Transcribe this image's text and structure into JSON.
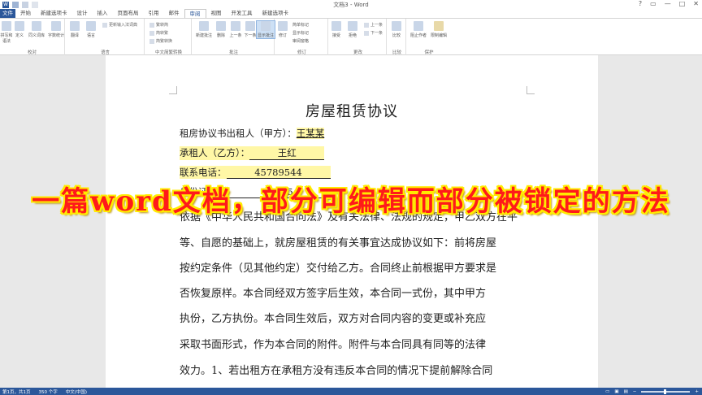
{
  "window": {
    "title": "文档3 - Word",
    "controls": [
      "?",
      "▭",
      "—",
      "□",
      "✕"
    ]
  },
  "ribbon_tabs": [
    "文件",
    "开始",
    "新建选项卡",
    "设计",
    "插入",
    "页面布局",
    "引用",
    "邮件",
    "审阅",
    "视图",
    "开发工具",
    "新建选项卡"
  ],
  "ribbon": {
    "proofing": {
      "label": "校对",
      "buttons": [
        "拼写和语法",
        "定义",
        "同义词库",
        "字数统计"
      ]
    },
    "language": {
      "label": "语言",
      "buttons": [
        "翻译",
        "语言"
      ],
      "small": "更新输入法词典"
    },
    "chinese": {
      "label": "中文简繁转换",
      "items": [
        "繁转简",
        "简转繁",
        "简繁转换"
      ]
    },
    "comments": {
      "label": "批注",
      "buttons": [
        "新建批注",
        "删除",
        "上一条",
        "下一条",
        "显示批注"
      ]
    },
    "tracking": {
      "label": "修订",
      "buttons": [
        "修订"
      ],
      "dropdowns": [
        "简单标记",
        "显示标记",
        "审阅窗格"
      ]
    },
    "changes": {
      "label": "更改",
      "buttons": [
        "接受",
        "拒绝"
      ],
      "small": [
        "上一条",
        "下一条"
      ]
    },
    "compare": {
      "label": "比较",
      "buttons": [
        "比较"
      ]
    },
    "protect": {
      "label": "保护",
      "buttons": [
        "阻止作者",
        "限制编辑"
      ]
    }
  },
  "document": {
    "title": "房屋租赁协议",
    "lessor_line": "租房协议书出租人（甲方）：",
    "lessor_name": "王某某",
    "lessee_label": "承租人（乙方）：",
    "lessee_name": "王红",
    "phone_label": "联系电话：",
    "phone_value": "45789544",
    "id_label": "身份证号：",
    "id_value": "9  3  25",
    "paragraphs": [
      "依据《中华人民共和国合同法》及有关法律、法规的规定，甲乙双方在平",
      "等、自愿的基础上，就房屋租赁的有关事宜达成协议如下：前将房屋",
      "按约定条件（见其他约定）交付给乙方。合同终止前根据甲方要求是",
      "否恢复原样。本合同经双方签字后生效，本合同一式份，其中甲方",
      "执份，乙方执份。本合同生效后，双方对合同内容的变更或补充应",
      "采取书面形式，作为本合同的附件。附件与本合同具有同等的法律",
      "效力。1、若出租方在承租方没有违反本合同的情况下提前解除合同"
    ]
  },
  "banner": "一篇word文档，部分可编辑而部分被锁定的方法",
  "status": {
    "page": "第1页，共1页",
    "words": "350 个字",
    "lang": "中文(中国)"
  },
  "colors": {
    "accent": "#2b579a",
    "banner_text": "#ff1a1a",
    "banner_outline": "#ffeb00",
    "highlight": "#fff7a6"
  }
}
